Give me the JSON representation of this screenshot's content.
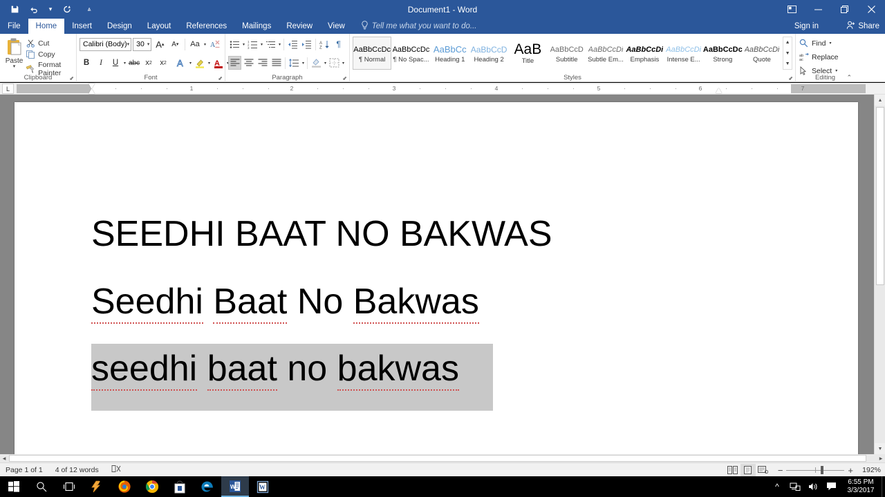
{
  "window": {
    "title": "Document1 - Word",
    "quick_access": [
      "save-icon",
      "undo-icon",
      "redo-icon",
      "customize-qat-icon"
    ],
    "ribbon_display_options": "ribbon-display-icon",
    "minimize": "minimize-icon",
    "restore": "restore-icon",
    "close": "close-icon"
  },
  "tabs": [
    {
      "label": "File",
      "active": false
    },
    {
      "label": "Home",
      "active": true
    },
    {
      "label": "Insert",
      "active": false
    },
    {
      "label": "Design",
      "active": false
    },
    {
      "label": "Layout",
      "active": false
    },
    {
      "label": "References",
      "active": false
    },
    {
      "label": "Mailings",
      "active": false
    },
    {
      "label": "Review",
      "active": false
    },
    {
      "label": "View",
      "active": false
    }
  ],
  "tell_me": "Tell me what you want to do...",
  "sign_in": "Sign in",
  "share": "Share",
  "ribbon": {
    "clipboard": {
      "group_label": "Clipboard",
      "paste_label": "Paste",
      "items": [
        {
          "label": "Cut",
          "icon": "scissors-icon"
        },
        {
          "label": "Copy",
          "icon": "copy-icon"
        },
        {
          "label": "Format Painter",
          "icon": "format-painter-icon"
        }
      ]
    },
    "font": {
      "group_label": "Font",
      "font_name": "Calibri (Body)",
      "font_size": "30",
      "buttons_row1": [
        "grow-font-icon",
        "shrink-font-icon",
        "change-case-icon",
        "clear-formatting-icon"
      ],
      "buttons_row2": [
        "bold-icon",
        "italic-icon",
        "underline-icon",
        "strikethrough-icon",
        "subscript-icon",
        "superscript-icon",
        "text-effects-icon",
        "text-highlight-icon",
        "font-color-icon"
      ],
      "bold": "B",
      "italic": "I",
      "underline": "U",
      "strikethrough": "abc",
      "subscript": "x",
      "superscript": "x",
      "change_case": "Aa",
      "grow_font": "A",
      "shrink_font": "A"
    },
    "paragraph": {
      "group_label": "Paragraph",
      "row1": [
        "bullets-icon",
        "numbering-icon",
        "multilevel-list-icon",
        "decrease-indent-icon",
        "increase-indent-icon",
        "sort-icon",
        "show-formatting-marks-icon"
      ],
      "row2": [
        "align-left-icon",
        "align-center-icon",
        "align-right-icon",
        "justify-icon",
        "line-spacing-icon",
        "shading-icon",
        "borders-icon"
      ]
    },
    "styles": {
      "group_label": "Styles",
      "items": [
        {
          "preview": "AaBbCcDc",
          "name": "Normal",
          "selected": true,
          "mark": "¶"
        },
        {
          "preview": "AaBbCcDc",
          "name": "No Spac...",
          "selected": false,
          "mark": "¶"
        },
        {
          "preview": "AaBbCс",
          "name": "Heading 1",
          "selected": false,
          "mark": ""
        },
        {
          "preview": "AaBbCcD",
          "name": "Heading 2",
          "selected": false,
          "mark": ""
        },
        {
          "preview": "AaB",
          "name": "Title",
          "selected": false,
          "mark": ""
        },
        {
          "preview": "AaBbCcD",
          "name": "Subtitle",
          "selected": false,
          "mark": ""
        },
        {
          "preview": "AaBbCcDi",
          "name": "Subtle Em...",
          "selected": false,
          "mark": ""
        },
        {
          "preview": "AaBbCcDi",
          "name": "Emphasis",
          "selected": false,
          "mark": ""
        },
        {
          "preview": "AaBbCcDi",
          "name": "Intense E...",
          "selected": false,
          "mark": ""
        },
        {
          "preview": "AaBbCcDc",
          "name": "Strong",
          "selected": false,
          "mark": ""
        },
        {
          "preview": "AaBbCcDi",
          "name": "Quote",
          "selected": false,
          "mark": ""
        }
      ]
    },
    "editing": {
      "group_label": "Editing",
      "items": [
        {
          "label": "Find",
          "icon": "find-icon",
          "caret": true
        },
        {
          "label": "Replace",
          "icon": "replace-icon",
          "caret": false
        },
        {
          "label": "Select",
          "icon": "select-icon",
          "caret": true
        }
      ]
    }
  },
  "ruler": {
    "numbers": [
      "1",
      "2",
      "3",
      "4",
      "5",
      "6",
      "7"
    ],
    "tab_stop": "L"
  },
  "document": {
    "lines": [
      {
        "text": "SEEDHI BAAT NO BAKWAS",
        "selected": false,
        "misspelled": []
      },
      {
        "text": "Seedhi Baat No Bakwas",
        "selected": false,
        "misspelled": [
          "Seedhi",
          "Baat",
          "Bakwas"
        ]
      },
      {
        "text": "seedhi baat no bakwas",
        "selected": true,
        "misspelled": [
          "seedhi",
          "baat",
          "bakwas"
        ]
      }
    ],
    "line2_words": [
      "Seedhi",
      "Baat",
      "No",
      "Bakwas"
    ],
    "line3_words": [
      "seedhi",
      "baat",
      "no",
      "bakwas"
    ]
  },
  "status_bar": {
    "page": "Page 1 of 1",
    "words": "4 of 12 words",
    "proofing_icon": "proofing-errors-icon",
    "views": [
      {
        "name": "read-mode-view-button",
        "active": false
      },
      {
        "name": "print-layout-view-button",
        "active": true
      },
      {
        "name": "web-layout-view-button",
        "active": false
      }
    ],
    "zoom_out": "−",
    "zoom_in": "+",
    "zoom_level": "192%"
  },
  "taskbar": {
    "items": [
      {
        "name": "start-button",
        "icon": "windows-logo-icon",
        "active": false
      },
      {
        "name": "search-button",
        "icon": "search-icon",
        "active": false
      },
      {
        "name": "task-view-button",
        "icon": "task-view-icon",
        "active": false
      },
      {
        "name": "taskbar-app-zap",
        "icon": "lightning-icon",
        "active": false
      },
      {
        "name": "taskbar-app-firefox",
        "icon": "firefox-icon",
        "active": false
      },
      {
        "name": "taskbar-app-chrome",
        "icon": "chrome-icon",
        "active": false
      },
      {
        "name": "taskbar-app-store",
        "icon": "store-icon",
        "active": false
      },
      {
        "name": "taskbar-app-edge",
        "icon": "edge-icon",
        "active": false
      },
      {
        "name": "taskbar-app-word",
        "icon": "word-icon",
        "active": true
      },
      {
        "name": "taskbar-app-wordpad",
        "icon": "wordpad-icon",
        "active": false
      }
    ],
    "tray": [
      "show-hidden-icons-chevron",
      "network-icon",
      "volume-icon",
      "action-center-icon"
    ],
    "time": "6:55 PM",
    "date": "3/3/2017"
  },
  "colors": {
    "word_blue": "#2b579a",
    "doc_background": "#868686",
    "selection_gray": "#c8c8c8",
    "spellcheck_red": "#d05050",
    "accent_light": "#5b9bd5"
  }
}
